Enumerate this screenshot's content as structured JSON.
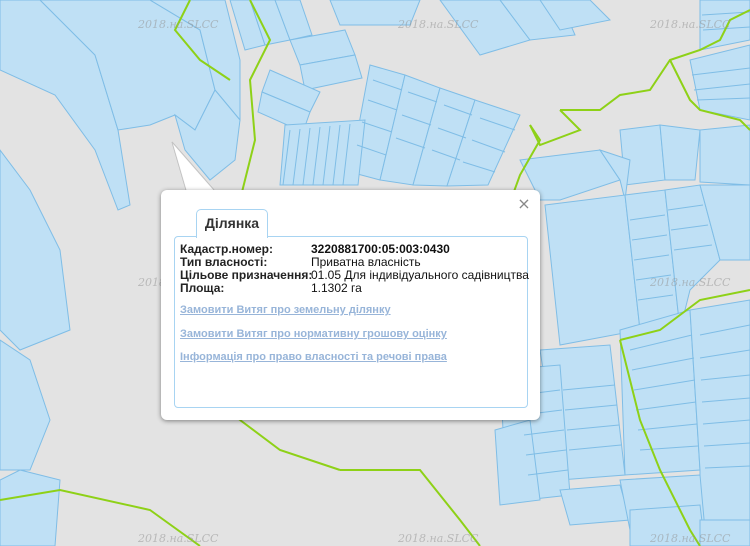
{
  "map": {
    "watermark": "2018.на.SLCC",
    "colors": {
      "background": "#e3e3e3",
      "parcel_fill": "#bfe0f5",
      "parcel_stroke": "#7fbde6",
      "boundary": "#8ed117"
    }
  },
  "popup": {
    "tab_label": "Ділянка",
    "close_icon": "×",
    "fields": [
      {
        "label": "Кадастр.номер:",
        "value": "3220881700:05:003:0430",
        "bold": true
      },
      {
        "label": "Тип власності:",
        "value": "Приватна власність",
        "bold": false
      },
      {
        "label": "Цільове призначення:",
        "value": "01.05 Для індивідуального садівництва",
        "bold": false
      },
      {
        "label": "Площа:",
        "value": "1.1302 га",
        "bold": false
      }
    ],
    "links": [
      "Замовити Витяг про земельну ділянку",
      "Замовити Витяг про нормативну грошову оцінку",
      "Інформація про право власності та речові права"
    ]
  }
}
